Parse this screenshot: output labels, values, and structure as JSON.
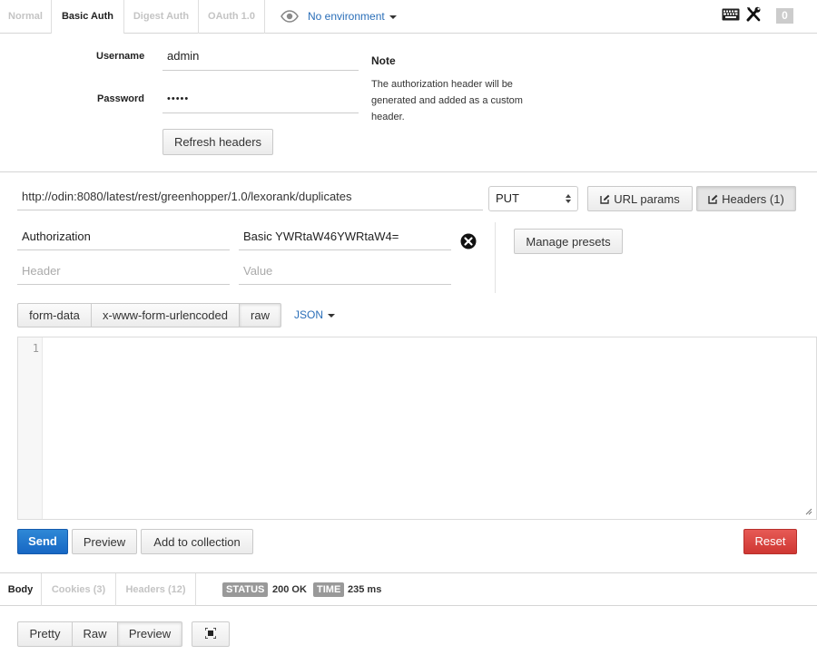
{
  "auth_tabs": [
    {
      "label": "Normal",
      "active": false
    },
    {
      "label": "Basic Auth",
      "active": true
    },
    {
      "label": "Digest Auth",
      "active": false
    },
    {
      "label": "OAuth 1.0",
      "active": false
    }
  ],
  "environment": {
    "label": "No environment",
    "icon": "eye-icon"
  },
  "toolbar": {
    "keyboard_icon": "keyboard-icon",
    "settings_icon": "wrench-screwdriver-icon",
    "badge_count": "0"
  },
  "basic_auth": {
    "username_label": "Username",
    "username_value": "admin",
    "password_label": "Password",
    "password_value": "•••••",
    "refresh_button": "Refresh headers",
    "note_title": "Note",
    "note_lines": [
      "The authorization header will be",
      "generated and added as a custom",
      "header."
    ]
  },
  "request": {
    "url": "http://odin:8080/latest/rest/greenhopper/1.0/lexorank/duplicates",
    "method": "PUT",
    "url_params_button": "URL params",
    "headers_button": "Headers (1)"
  },
  "headers": {
    "rows": [
      {
        "key": "Authorization",
        "value": "Basic YWRtaW46YWRtaW4="
      }
    ],
    "key_placeholder": "Header",
    "value_placeholder": "Value",
    "manage_presets_button": "Manage presets"
  },
  "body_modes": {
    "options": [
      "form-data",
      "x-www-form-urlencoded",
      "raw"
    ],
    "selected": "raw",
    "language": "JSON"
  },
  "editor": {
    "line_number": "1",
    "content": ""
  },
  "actions": {
    "send": "Send",
    "preview": "Preview",
    "add_to_collection": "Add to collection",
    "reset": "Reset"
  },
  "colors": {
    "accent_blue": "#2a6eb8",
    "send_blue": "#1767c4",
    "reset_red": "#cf3733"
  },
  "response": {
    "tabs": [
      {
        "label": "Body",
        "active": true
      },
      {
        "label": "Cookies (3)",
        "active": false
      },
      {
        "label": "Headers (12)",
        "active": false
      }
    ],
    "status_label": "STATUS",
    "status_value": "200 OK",
    "time_label": "TIME",
    "time_value": "235 ms",
    "view_modes": [
      "Pretty",
      "Raw",
      "Preview"
    ],
    "selected_view": "Preview",
    "fullscreen_icon": "fullscreen-icon"
  }
}
